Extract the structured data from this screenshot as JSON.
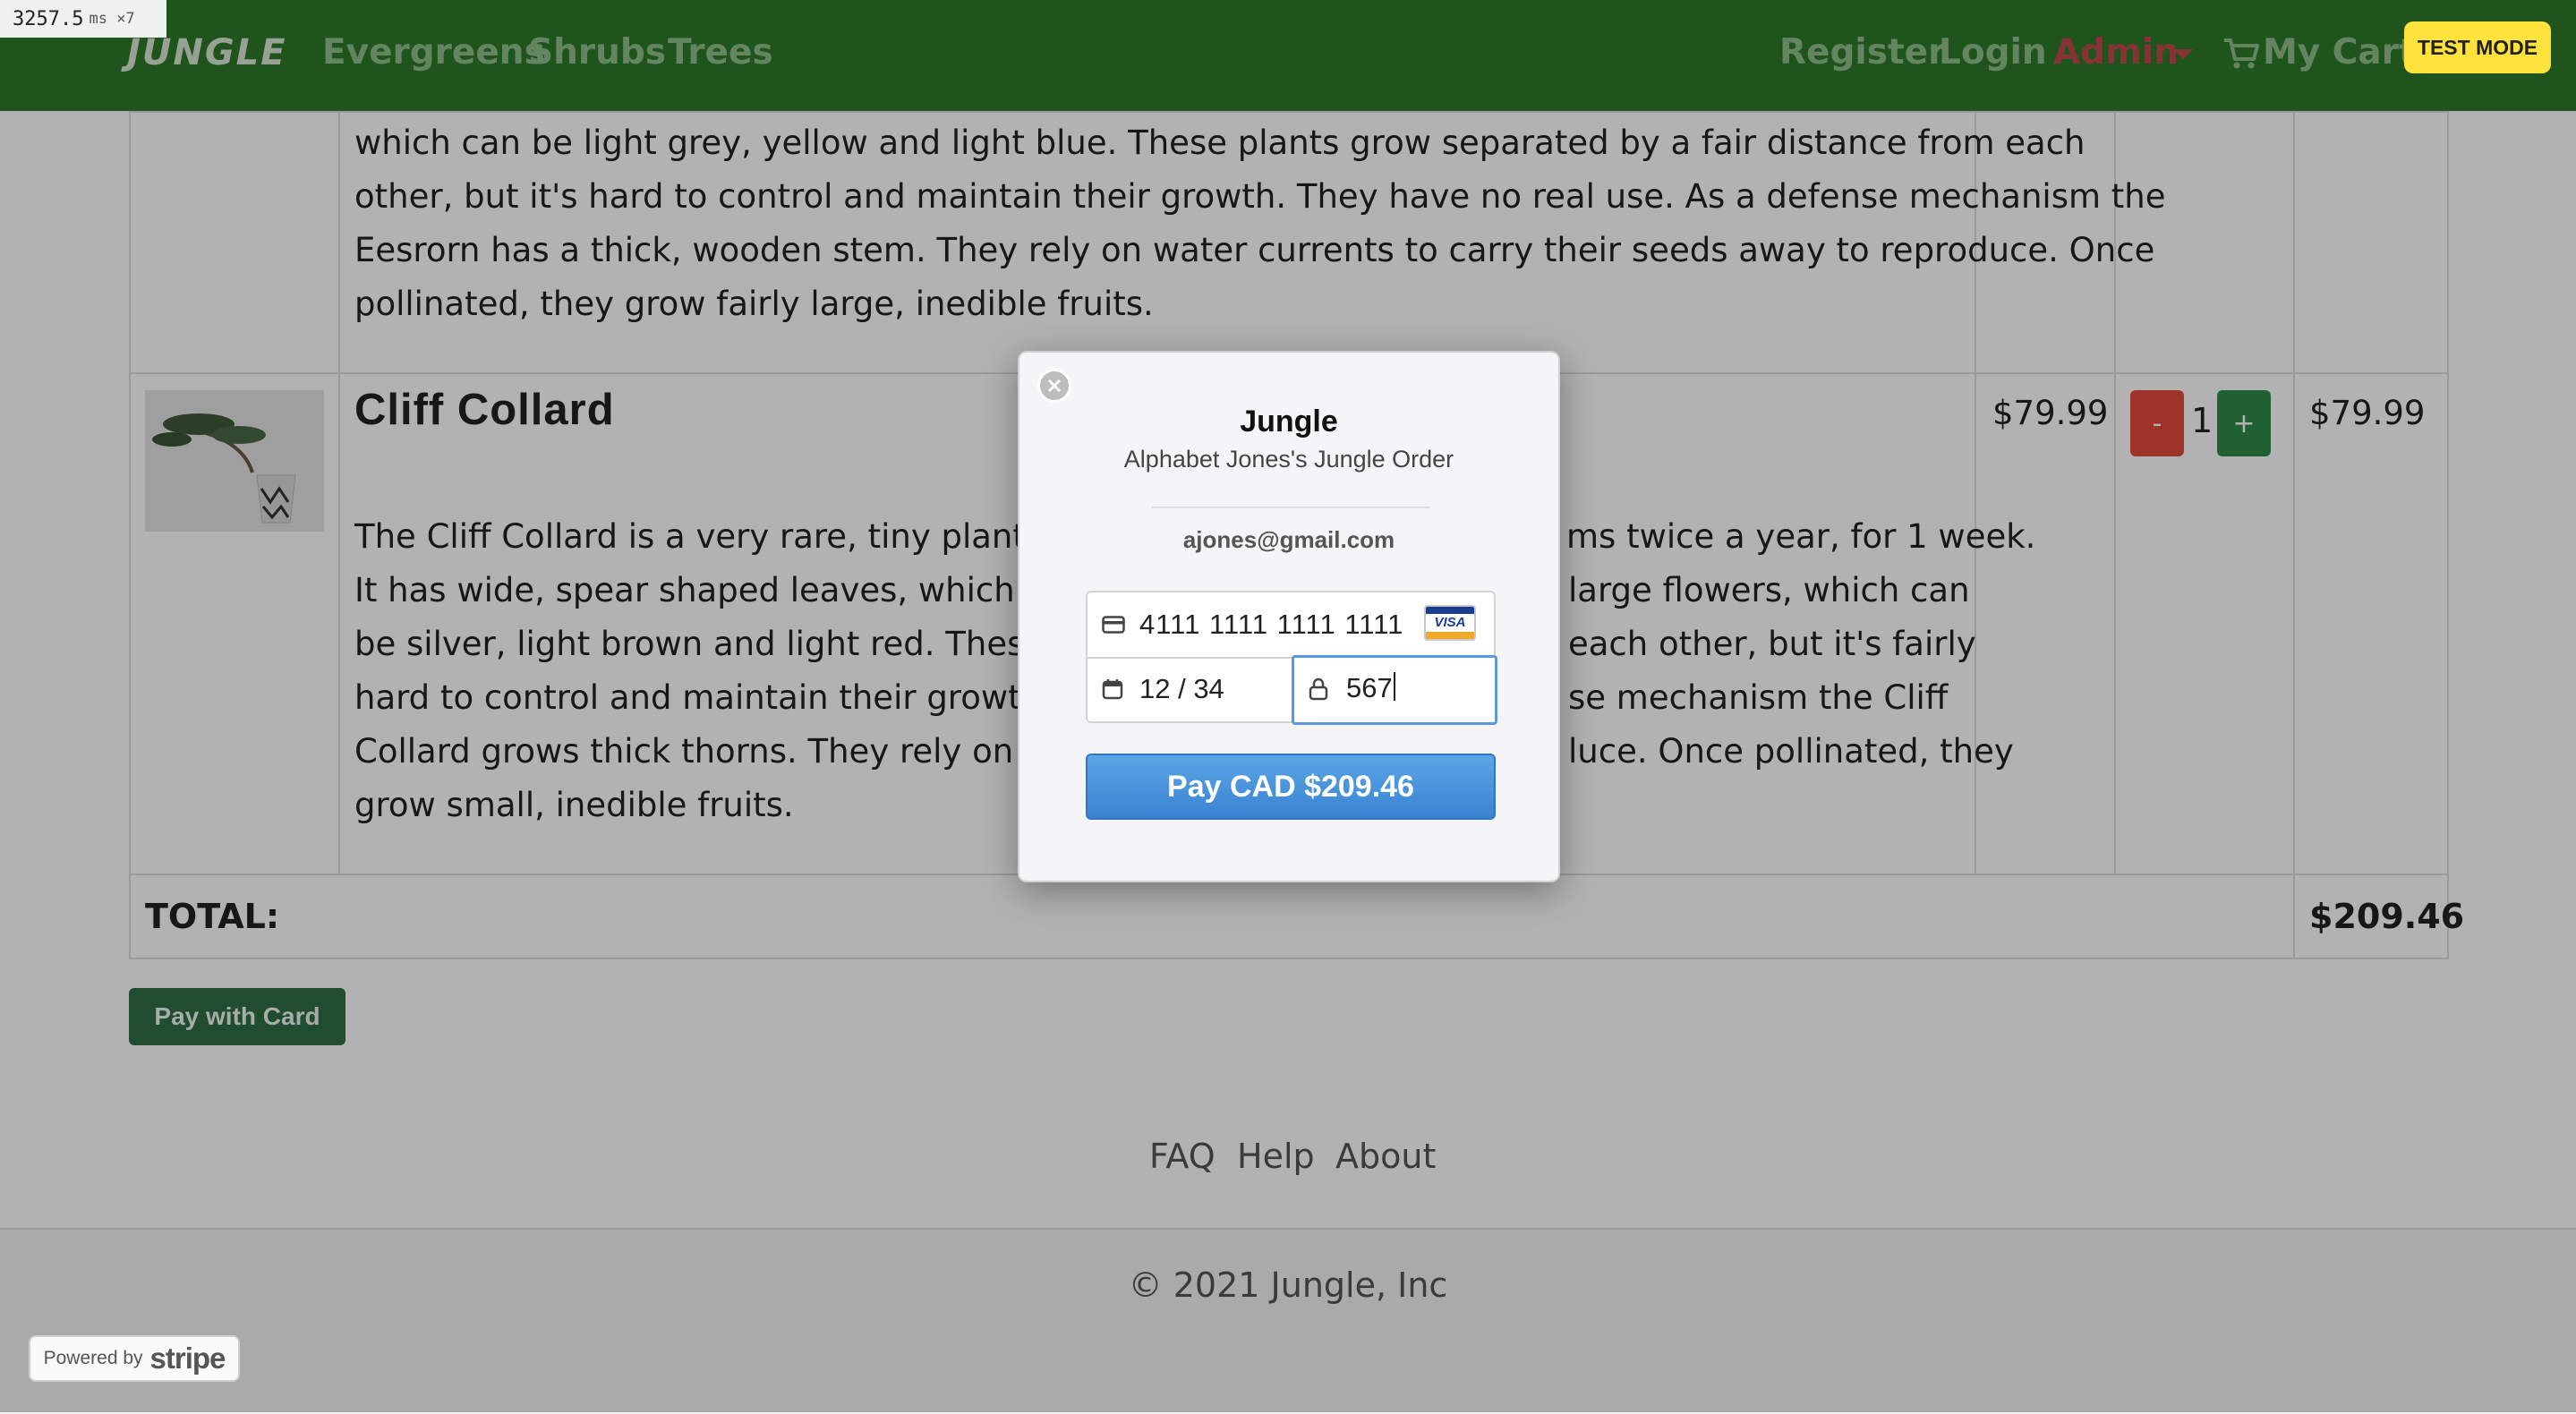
{
  "perf_overlay": {
    "time": "3257.5",
    "unit": "ms ×7"
  },
  "nav": {
    "brand": "JUNGLE",
    "links": [
      "Evergreens",
      "Shrubs",
      "Trees"
    ],
    "register": "Register",
    "login": "Login",
    "admin": "Admin",
    "cart": "My Cart (",
    "icons": {
      "cart": "shopping-cart-icon",
      "admin_caret": "caret-down-icon"
    }
  },
  "test_mode": "TEST MODE",
  "previous_item": {
    "description_lines": [
      "which can be light grey, yellow and light blue. These plants grow separated by a fair distance from each",
      "other, but it's hard to control and maintain their growth. They have no real use. As a defense mechanism the",
      "Eesrorn has a thick, wooden stem. They rely on water currents to carry their seeds away to reproduce. Once",
      "pollinated, they grow fairly large, inedible fruits."
    ]
  },
  "item": {
    "name": "Cliff Collard",
    "price": "$79.99",
    "quantity": "1",
    "minus_label": "-",
    "plus_label": "+",
    "subtotal": "$79.99",
    "description_lines": [
      "The Cliff Collard is a very rare, tiny plant and",
      "It has wide, spear shaped leaves, which are u",
      "be silver, light brown and light red. These pla",
      "hard to control and maintain their growth. Th",
      "Collard grows thick thorns. They rely on wind",
      "grow small, inedible fruits."
    ],
    "description_right_lines": [
      "ms twice a year, for 1 week.",
      "large flowers, which can",
      "each other, but it's fairly",
      "se mechanism the Cliff",
      "luce. Once pollinated, they"
    ]
  },
  "total": {
    "label": "TOTAL:",
    "value": "$209.46"
  },
  "pay_with_card": "Pay with Card",
  "footer": {
    "links": [
      "FAQ",
      "Help",
      "About"
    ],
    "copyright": "© 2021 Jungle, Inc",
    "powered_by": "Powered by",
    "stripe": "stripe"
  },
  "checkout_modal": {
    "title": "Jungle",
    "subtitle": "Alphabet Jones's Jungle Order",
    "email": "ajones@gmail.com",
    "card_number": "4111 1111 1111 1111",
    "card_brand": "VISA",
    "expiry": "12 / 34",
    "cvc": "567",
    "pay_button": "Pay CAD $209.46",
    "icons": {
      "close": "close-icon",
      "card": "credit-card-icon",
      "calendar": "calendar-icon",
      "lock": "lock-icon"
    }
  },
  "colors": {
    "nav_bg": "#2d7a2a",
    "admin": "#c14a4a",
    "test_badge": "#ffe23b",
    "pay_button": "#3a83d2",
    "pay_with_card": "#2e6d44",
    "minus": "#e24a3c",
    "plus": "#2e8b49"
  }
}
